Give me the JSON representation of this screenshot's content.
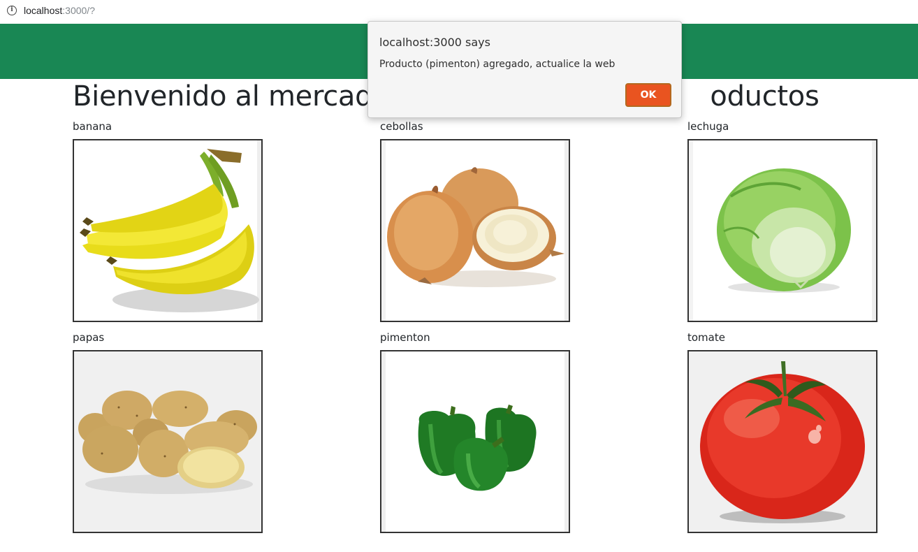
{
  "browser": {
    "url_host": "localhost",
    "url_path": ":3000/?"
  },
  "page": {
    "title_left": "Bienvenido al mercado",
    "title_right": "oductos"
  },
  "products": [
    {
      "name": "banana"
    },
    {
      "name": "cebollas"
    },
    {
      "name": "lechuga"
    },
    {
      "name": "papas"
    },
    {
      "name": "pimenton"
    },
    {
      "name": "tomate"
    }
  ],
  "dialog": {
    "title": "localhost:3000 says",
    "message": "Producto (pimenton) agregado, actualice la web",
    "ok_label": "OK"
  },
  "colors": {
    "navbar": "#198754",
    "ok_button": "#e95420"
  }
}
